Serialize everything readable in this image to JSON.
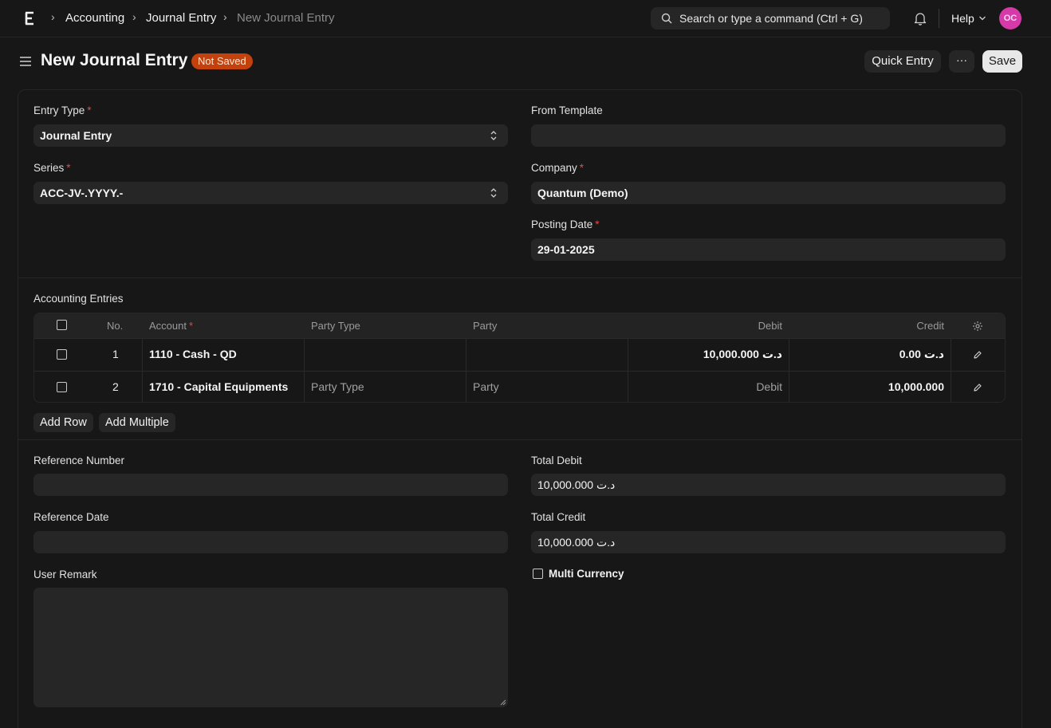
{
  "navbar": {
    "breadcrumbs": [
      "Accounting",
      "Journal Entry",
      "New Journal Entry"
    ],
    "search_placeholder": "Search or type a command (Ctrl + G)",
    "help_label": "Help",
    "avatar_initials": "OC",
    "avatar_color": "#d63aa8"
  },
  "header": {
    "title": "New Journal Entry",
    "status": "Not Saved",
    "status_color": "#c2410c",
    "quick_entry_label": "Quick Entry",
    "more_label": "···",
    "save_label": "Save"
  },
  "form": {
    "entry_type": {
      "label": "Entry Type",
      "value": "Journal Entry"
    },
    "from_template": {
      "label": "From Template",
      "value": ""
    },
    "series": {
      "label": "Series",
      "value": "ACC-JV-.YYYY.-"
    },
    "company": {
      "label": "Company",
      "value": "Quantum (Demo)"
    },
    "posting_date": {
      "label": "Posting Date",
      "value": "29-01-2025"
    },
    "required_mark": "*"
  },
  "accounting_entries": {
    "section_label": "Accounting Entries",
    "columns": [
      "No.",
      "Account",
      "Party Type",
      "Party",
      "Debit",
      "Credit"
    ],
    "rows": [
      {
        "no": "1",
        "account": "1110 - Cash - QD",
        "party_type": "",
        "party": "",
        "debit": "د.ت 10,000.000",
        "credit": "د.ت 0.00"
      },
      {
        "no": "2",
        "account": "1710 - Capital Equipments",
        "party_type": "Party Type",
        "party": "Party",
        "debit": "Debit",
        "credit": "10,000.000"
      }
    ],
    "add_row_label": "Add Row",
    "add_multiple_label": "Add Multiple"
  },
  "reference": {
    "reference_number": {
      "label": "Reference Number",
      "value": ""
    },
    "reference_date": {
      "label": "Reference Date",
      "value": ""
    },
    "user_remark": {
      "label": "User Remark",
      "value": ""
    },
    "total_debit": {
      "label": "Total Debit",
      "value": "10,000.000 د.ت"
    },
    "total_credit": {
      "label": "Total Credit",
      "value": "10,000.000 د.ت"
    },
    "multi_currency": {
      "label": "Multi Currency",
      "checked": false
    }
  }
}
